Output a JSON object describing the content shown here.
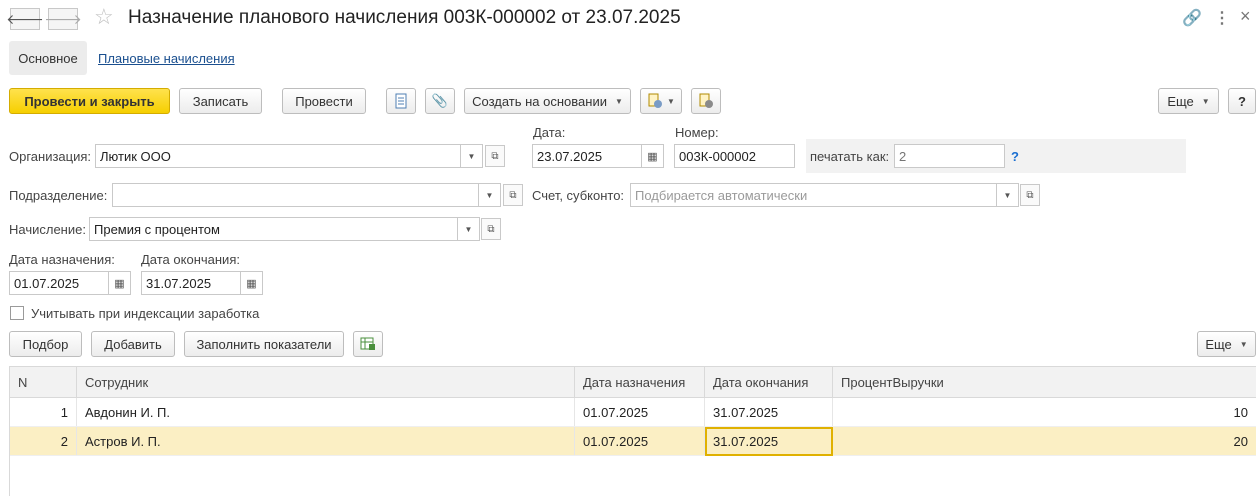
{
  "window": {
    "title": "Назначение планового начисления 003К-000002 от 23.07.2025"
  },
  "icons": {
    "back": "arrow-left-icon",
    "forward": "arrow-right-icon",
    "favorite": "star-icon",
    "link": "link-icon",
    "more": "kebab-menu-icon",
    "close": "close-icon"
  },
  "tabs": [
    {
      "label": "Основное",
      "active": true
    },
    {
      "label": "Плановые начисления",
      "active": false
    }
  ],
  "toolbar": {
    "post_close": "Провести и закрыть",
    "write": "Записать",
    "post": "Провести",
    "create_based": "Создать на основании",
    "more": "Еще",
    "help": "?"
  },
  "form": {
    "org_label": "Организация:",
    "org_value": "Лютик ООО",
    "date_label": "Дата:",
    "date_value": "23.07.2025",
    "number_label": "Номер:",
    "number_value": "003К-000002",
    "print_as_label": "печатать как:",
    "print_as_placeholder": "2",
    "print_help": "?",
    "dept_label": "Подразделение:",
    "dept_value": "",
    "account_label": "Счет, субконто:",
    "account_placeholder": "Подбирается автоматически",
    "accrual_label": "Начисление:",
    "accrual_value": "Премия с процентом",
    "start_label": "Дата назначения:",
    "start_value": "01.07.2025",
    "end_label": "Дата окончания:",
    "end_value": "31.07.2025",
    "indexation_label": "Учитывать при индексации заработка",
    "indexation_checked": false
  },
  "table_toolbar": {
    "select": "Подбор",
    "add": "Добавить",
    "fill": "Заполнить показатели",
    "more": "Еще"
  },
  "table": {
    "columns": [
      "N",
      "Сотрудник",
      "Дата назначения",
      "Дата окончания",
      "ПроцентВыручки"
    ],
    "rows": [
      {
        "n": "1",
        "employee": "Авдонин И. П.",
        "start": "01.07.2025",
        "end": "31.07.2025",
        "percent": "10"
      },
      {
        "n": "2",
        "employee": "Астров И. П.",
        "start": "01.07.2025",
        "end": "31.07.2025",
        "percent": "20"
      }
    ]
  },
  "colors": {
    "primary_button": "#f6cf00",
    "selected_row": "#fbefc4",
    "link": "#1a4f8f",
    "help": "#1a6fd1"
  }
}
